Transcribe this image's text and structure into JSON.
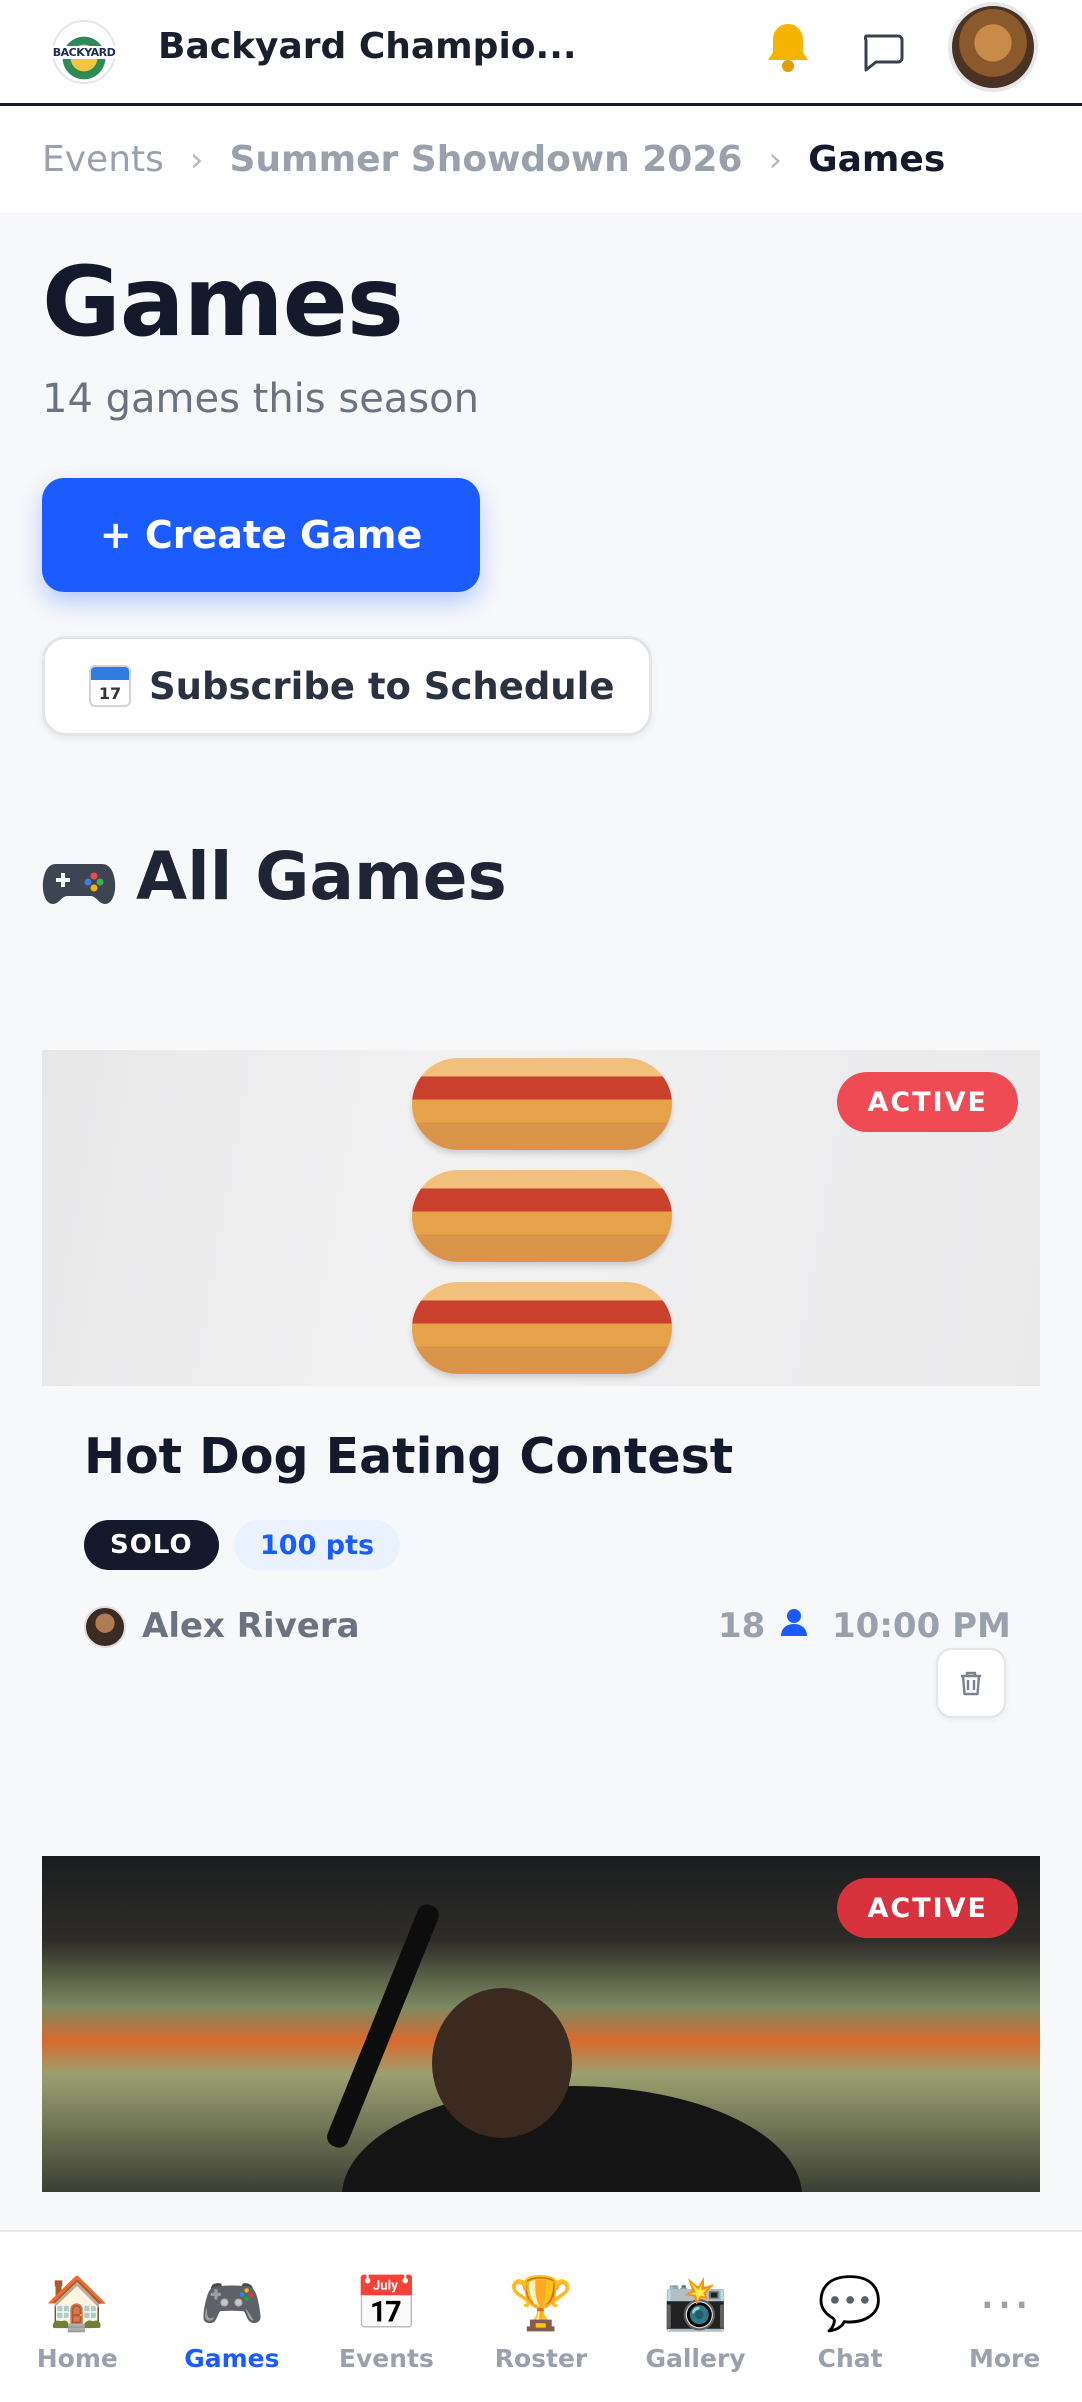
{
  "header": {
    "logo_text": "BACKYARD",
    "app_title": "Backyard Champio...",
    "icons": {
      "notifications": "bell-icon",
      "messages": "chat-bubble-icon",
      "profile": "user-avatar"
    }
  },
  "breadcrumb": {
    "items": [
      "Events",
      "Summer Showdown 2026",
      "Games"
    ],
    "separator": "›"
  },
  "page": {
    "title": "Games",
    "subtitle": "14 games this season",
    "create_button": "+ Create Game",
    "subscribe_button": "Subscribe to Schedule",
    "calendar_day": "17"
  },
  "section": {
    "title": "All Games",
    "icon": "gamepad-icon"
  },
  "games": [
    {
      "status": "ACTIVE",
      "title": "Hot Dog Eating Contest",
      "type": "SOLO",
      "points": "100 pts",
      "host": "Alex Rivera",
      "participants": "18",
      "time": "10:00 PM"
    },
    {
      "status": "ACTIVE"
    }
  ],
  "bottom_nav": [
    {
      "label": "Home",
      "icon": "🏠"
    },
    {
      "label": "Games",
      "icon": "🎮",
      "active": true
    },
    {
      "label": "Events",
      "icon": "📅"
    },
    {
      "label": "Roster",
      "icon": "🏆"
    },
    {
      "label": "Gallery",
      "icon": "📸"
    },
    {
      "label": "Chat",
      "icon": "💬"
    },
    {
      "label": "More",
      "icon": "⋯"
    }
  ],
  "colors": {
    "primary": "#1a5cff",
    "active_badge": "#ef4b55",
    "text_dark": "#141a2b",
    "text_muted": "#9aa1ad"
  }
}
